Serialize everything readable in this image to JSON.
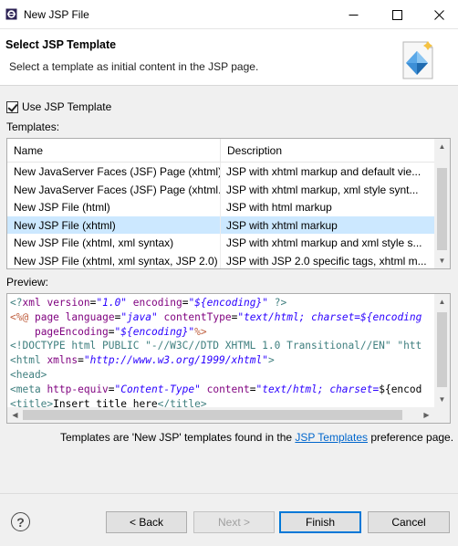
{
  "window": {
    "title": "New JSP File",
    "minimize_icon": "minimize-icon",
    "maximize_icon": "maximize-icon",
    "close_icon": "close-icon"
  },
  "banner": {
    "heading": "Select JSP Template",
    "description": "Select a template as initial content in the JSP page.",
    "icon": "wizard-diamond-icon"
  },
  "use_template": {
    "label": "Use JSP Template",
    "checked": true
  },
  "templates": {
    "label": "Templates:",
    "columns": [
      "Name",
      "Description"
    ],
    "rows": [
      {
        "name": "New JavaServer Faces (JSF) Page (xhtml)",
        "description": "JSP with xhtml markup and default vie..."
      },
      {
        "name": "New JavaServer Faces (JSF) Page (xhtml...",
        "description": "JSP with xhtml markup, xml style synt..."
      },
      {
        "name": "New JSP File (html)",
        "description": "JSP with html markup"
      },
      {
        "name": "New JSP File (xhtml)",
        "description": "JSP with xhtml markup",
        "selected": true
      },
      {
        "name": "New JSP File (xhtml, xml syntax)",
        "description": "JSP with xhtml markup and xml style s..."
      },
      {
        "name": "New JSP File (xhtml, xml syntax, JSP 2.0)",
        "description": "JSP with JSP 2.0 specific tags, xhtml m..."
      }
    ]
  },
  "preview": {
    "label": "Preview:",
    "lines": [
      "<?xml version=\"1.0\" encoding=\"${encoding}\" ?>",
      "<%@ page language=\"java\" contentType=\"text/html; charset=${encoding",
      "    pageEncoding=\"${encoding}\"%>",
      "<!DOCTYPE html PUBLIC \"-//W3C//DTD XHTML 1.0 Transitional//EN\" \"htt",
      "<html xmlns=\"http://www.w3.org/1999/xhtml\">",
      "<head>",
      "<meta http-equiv=\"Content-Type\" content=\"text/html; charset=${encod",
      "<title>Insert title here</title>"
    ]
  },
  "info": {
    "prefix": "Templates are 'New JSP' templates found in the ",
    "link": "JSP Templates",
    "suffix": " preference page."
  },
  "buttons": {
    "help_icon": "help-icon",
    "back": "< Back",
    "next": "Next >",
    "finish": "Finish",
    "cancel": "Cancel"
  }
}
